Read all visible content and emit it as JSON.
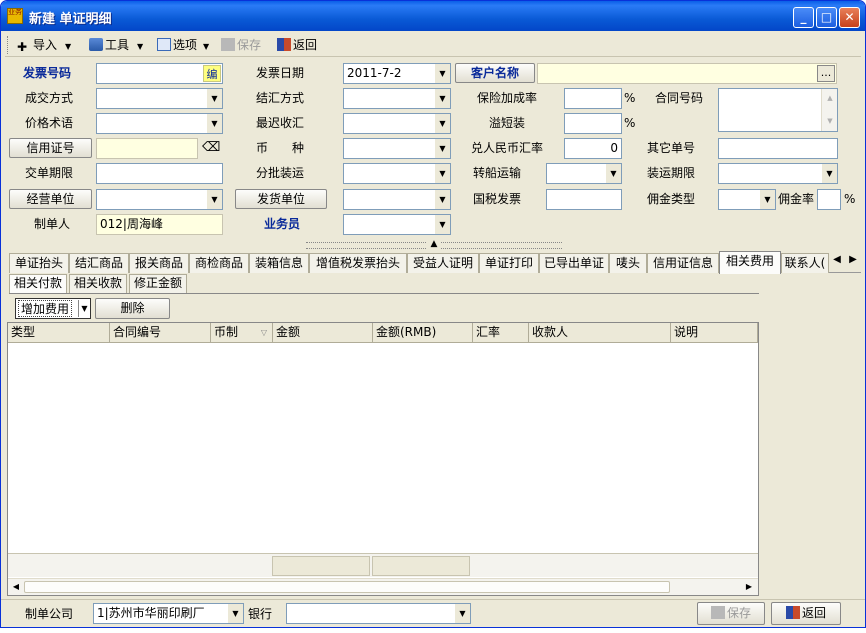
{
  "window": {
    "title": "新建 单证明细",
    "app_icon": "业务",
    "min_label": "_",
    "max_label": "□",
    "close_label": "✕"
  },
  "toolbar": {
    "import": "导入",
    "tools": "工具",
    "options": "选项",
    "save": "保存",
    "back": "返回"
  },
  "form": {
    "invoice_no": {
      "label": "发票号码",
      "value": "",
      "edit_btn": "编"
    },
    "invoice_date": {
      "label": "发票日期",
      "value": "2011-7-2"
    },
    "customer": {
      "label": "客户名称",
      "value": "",
      "more_btn": "..."
    },
    "deal_mode": {
      "label": "成交方式",
      "value": ""
    },
    "settle_mode": {
      "label": "结汇方式",
      "value": ""
    },
    "insurance_rate": {
      "label": "保险加成率",
      "value": "",
      "unit": "%"
    },
    "contract_no": {
      "label": "合同号码",
      "value": ""
    },
    "price_terms": {
      "label": "价格术语",
      "value": ""
    },
    "latest_settle": {
      "label": "最迟收汇",
      "value": ""
    },
    "overshort": {
      "label": "溢短装",
      "value": "",
      "unit": "%"
    },
    "lc_no": {
      "label": "信用证号",
      "value": ""
    },
    "currency": {
      "label": "币　　种",
      "value": ""
    },
    "rmb_rate": {
      "label": "兑人民币汇率",
      "value": "0"
    },
    "other_no": {
      "label": "其它单号",
      "value": ""
    },
    "delivery_term": {
      "label": "交单期限",
      "value": ""
    },
    "partial_ship": {
      "label": "分批装运",
      "value": ""
    },
    "transship": {
      "label": "转船运输",
      "value": ""
    },
    "ship_term": {
      "label": "装运期限",
      "value": ""
    },
    "operating_unit": {
      "label": "经营单位",
      "value": ""
    },
    "shipper_unit": {
      "label": "发货单位",
      "value": ""
    },
    "tax_invoice": {
      "label": "国税发票",
      "value": ""
    },
    "commission_type": {
      "label": "佣金类型",
      "value": ""
    },
    "commission_rate": {
      "label": "佣金率",
      "value": "",
      "unit": "%"
    },
    "maker": {
      "label": "制单人",
      "value": "012|周海峰"
    },
    "salesman": {
      "label": "业务员",
      "value": ""
    }
  },
  "tabs": [
    {
      "label": "单证抬头"
    },
    {
      "label": "结汇商品"
    },
    {
      "label": "报关商品"
    },
    {
      "label": "商检商品"
    },
    {
      "label": "装箱信息"
    },
    {
      "label": "增值税发票抬头"
    },
    {
      "label": "受益人证明"
    },
    {
      "label": "单证打印"
    },
    {
      "label": "已导出单证"
    },
    {
      "label": "唛头"
    },
    {
      "label": "信用证信息"
    },
    {
      "label": "相关费用"
    },
    {
      "label": "联系人("
    }
  ],
  "active_tab": "相关费用",
  "subtabs": [
    {
      "label": "相关付款"
    },
    {
      "label": "相关收款"
    },
    {
      "label": "修正金额"
    }
  ],
  "grid_toolbar": {
    "add_fee": "增加费用",
    "delete": "删除"
  },
  "grid": {
    "columns": [
      "类型",
      "合同编号",
      "币制",
      "金额",
      "金额(RMB)",
      "汇率",
      "收款人",
      "说明"
    ],
    "rows": []
  },
  "bottom": {
    "company_label": "制单公司",
    "company_value": "1|苏州市华丽印刷厂",
    "bank_label": "银行",
    "bank_value": "",
    "save": "保存",
    "back": "返回"
  },
  "colors": {
    "titlebar": "#0a5fe8",
    "window_bg": "#ece9d8",
    "required_label": "#0a2a9a",
    "yellow_field": "#ffffe1"
  }
}
